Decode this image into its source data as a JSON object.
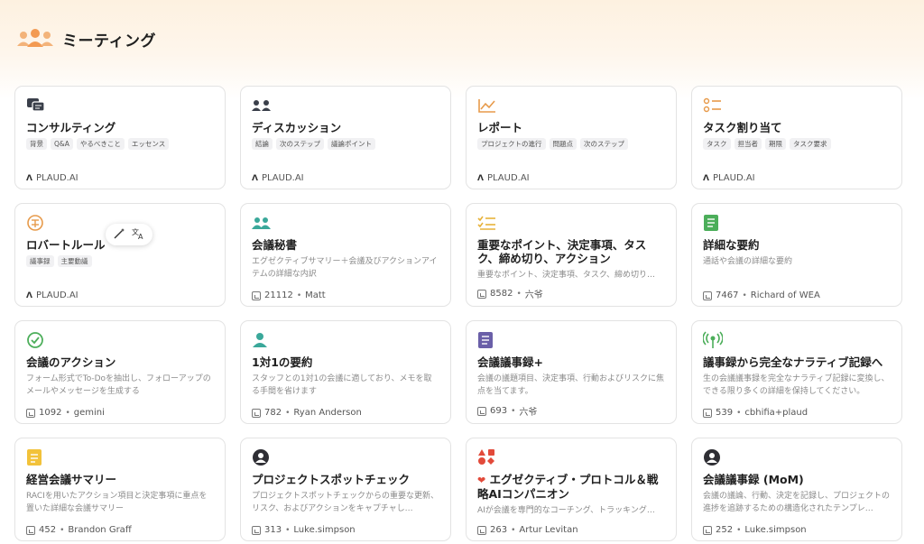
{
  "header": {
    "title": "ミーティング",
    "icon": "people-group-icon"
  },
  "cards": [
    {
      "title": "コンサルティング",
      "tags": [
        "背景",
        "Q&A",
        "やるべきこと",
        "エッセンス"
      ],
      "source": "PLAUD.AI",
      "icon": "chat-bubbles-icon"
    },
    {
      "title": "ディスカッション",
      "tags": [
        "結論",
        "次のステップ",
        "議論ポイント"
      ],
      "source": "PLAUD.AI",
      "icon": "two-people-icon"
    },
    {
      "title": "レポート",
      "tags": [
        "プロジェクトの進行",
        "問題点",
        "次のステップ"
      ],
      "source": "PLAUD.AI",
      "icon": "line-chart-icon"
    },
    {
      "title": "タスク割り当て",
      "tags": [
        "タスク",
        "担当者",
        "期限",
        "タスク要求"
      ],
      "source": "PLAUD.AI",
      "icon": "checklist-icon"
    },
    {
      "title": "ロバートルール",
      "tags": [
        "議事録",
        "主要動議"
      ],
      "source": "PLAUD.AI",
      "icon": "gavel-badge-icon"
    },
    {
      "title": "会議秘書",
      "desc": "エグゼクティブサマリー＋会議及びアクションアイテムの詳細な内訳",
      "uses": "21112",
      "author": "Matt",
      "icon": "team-icon"
    },
    {
      "title": "重要なポイント、決定事項、タスク、締め切り、アクション",
      "desc": "重要なポイント、決定事項、タスク、締め切り…",
      "uses": "8582",
      "author": "六爷",
      "icon": "check-list-icon"
    },
    {
      "title": "詳細な要約",
      "desc": "通話や会議の詳細な要約",
      "uses": "7467",
      "author": "Richard of WEA",
      "icon": "document-icon"
    },
    {
      "title": "会議のアクション",
      "desc": "フォーム形式でTo-Doを抽出し、フォローアップのメールやメッセージを生成する",
      "uses": "1092",
      "author": "gemini",
      "icon": "check-circle-icon"
    },
    {
      "title": "1対1の要約",
      "desc": "スタッフとの1対1の会議に適しており、メモを取る手間を省けます",
      "uses": "782",
      "author": "Ryan Anderson",
      "icon": "person-icon"
    },
    {
      "title": "会議議事録+",
      "desc": "会議の議題項目、決定事項、行動およびリスクに焦点を当てます。",
      "uses": "693",
      "author": "六爷",
      "icon": "notes-icon"
    },
    {
      "title": "議事録から完全なナラティブ記録へ",
      "desc": "生の会議議事録を完全なナラティブ記録に変換し、できる限り多くの詳細を保持してください。",
      "uses": "539",
      "author": "cbhifia+plaud",
      "icon": "broadcast-icon"
    },
    {
      "title": "経営会議サマリー",
      "desc": "RACIを用いたアクション項目と決定事項に重点を置いた詳細な会議サマリー",
      "uses": "452",
      "author": "Brandon Graff",
      "icon": "sticky-note-icon"
    },
    {
      "title": "プロジェクトスポットチェック",
      "desc": "プロジェクトスポットチェックからの重要な更新、リスク、およびアクションをキャプチャし…",
      "uses": "313",
      "author": "Luke.simpson",
      "icon": "avatar-icon"
    },
    {
      "title": "エグゼクティブ・プロトコル＆戦略AIコンパニオン",
      "desc": "AIが会議を専門的なコーチング、トラッキング…",
      "uses": "263",
      "author": "Artur Levitan",
      "icon": "shapes-icon"
    },
    {
      "title": "会議議事録 (MoM)",
      "desc": "会議の議論、行動、決定を記録し、プロジェクトの進捗を追跡するための構造化されたテンプレ…",
      "uses": "252",
      "author": "Luke.simpson",
      "icon": "avatar-icon"
    }
  ],
  "floating_tools": {
    "magic": "magic-wand-icon",
    "translate": "translate-icon"
  }
}
